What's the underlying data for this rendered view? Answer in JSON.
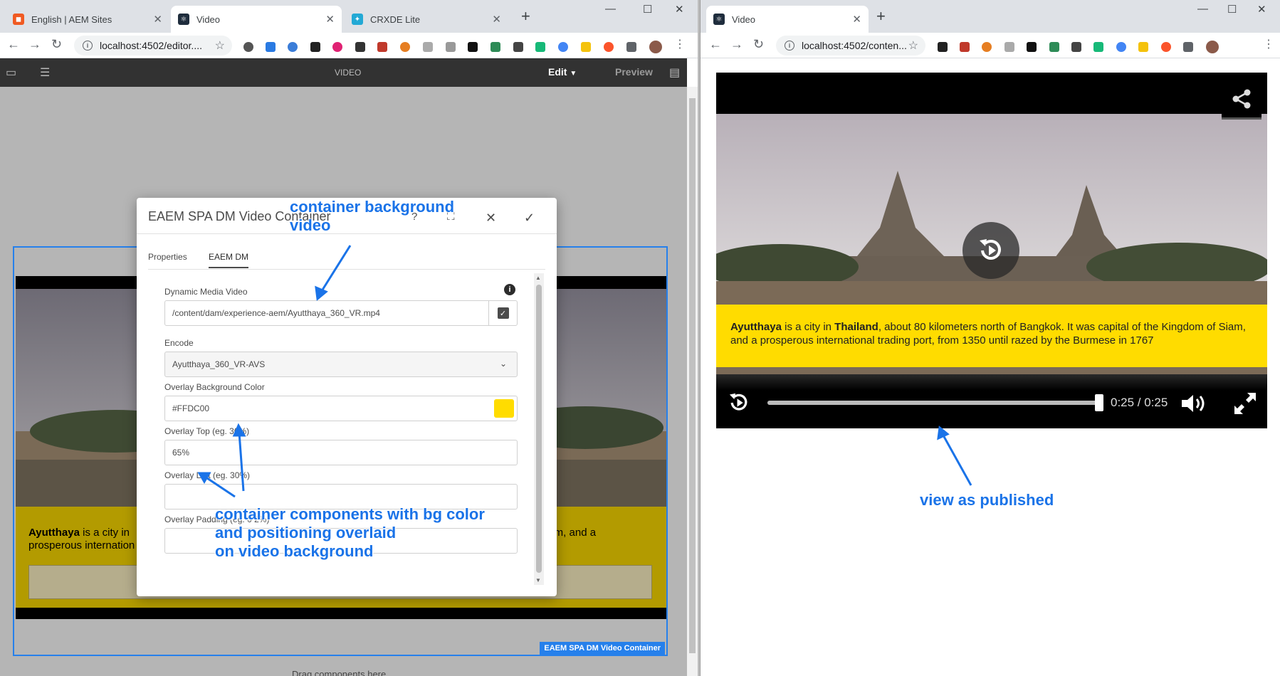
{
  "left_window": {
    "tabs": [
      {
        "title": "English | AEM Sites",
        "favicon_color": "#f05a22"
      },
      {
        "title": "Video",
        "favicon_color": "#1f2d3d",
        "active": true
      },
      {
        "title": "CRXDE Lite",
        "favicon_color": "#23a9d5"
      }
    ],
    "url": "localhost:4502/editor....",
    "aem_toolbar": {
      "page_title": "VIDEO",
      "edit_label": "Edit",
      "preview_label": "Preview"
    },
    "overlay_text_bold": "Ayutthaya",
    "overlay_text_start": "is a city in",
    "overlay_text_end": "iam, and a",
    "overlay_text_line2": "prosperous internation",
    "component_label": "EAEM SPA DM Video Container",
    "drag_hint": "Drag components here"
  },
  "dialog": {
    "title": "EAEM SPA DM Video Container",
    "tabs": [
      "Properties",
      "EAEM DM"
    ],
    "selected_tab": "EAEM DM",
    "fields": {
      "video_label": "Dynamic Media Video",
      "video_value": "/content/dam/experience-aem/Ayutthaya_360_VR.mp4",
      "encode_label": "Encode",
      "encode_value": "Ayutthaya_360_VR-AVS",
      "bg_color_label": "Overlay Background Color",
      "bg_color_value": "#FFDC00",
      "top_label": "Overlay Top (eg. 30%)",
      "top_value": "65%",
      "left_label": "Overlay Left (eg. 30%)",
      "left_value": "",
      "padding_label": "Overlay Padding (eg. 0 2%)",
      "padding_value": ""
    },
    "swatch_color": "#ffdc00"
  },
  "annotations": {
    "bg_video_line1": "container background",
    "bg_video_line2": "video",
    "components_line1": "container components with bg color",
    "components_line2": "and positioning overlaid",
    "components_line3": "on video background",
    "published": "view as published"
  },
  "right_window": {
    "tab_title": "Video",
    "url": "localhost:4502/conten...",
    "overlay": {
      "b1": "Ayutthaya",
      "t1": " is a city in ",
      "b2": "Thailand",
      "t2": ", about 80 kilometers north of Bangkok. It was capital of the Kingdom of Siam, and a prosperous international trading port, from 1350 until razed by the Burmese in 1767"
    },
    "time_display": "0:25 / 0:25",
    "progress_fraction": 1.0
  }
}
